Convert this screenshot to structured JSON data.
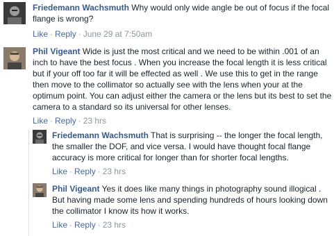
{
  "comments": [
    {
      "author": "Friedemann Wachsmuth",
      "text": "Why would only wide angle be out of focus if the focal flange is wrong?",
      "like": "Like",
      "reply": "Reply",
      "time": "June 29 at 7:50am",
      "avatar_icon": "person-photo-icon"
    },
    {
      "author": "Phil Vigeant",
      "text": "Wide is just the most critical and we need to be within .001 of an inch to have the best focus . When you increase the focal length it is less critical but if your off too far it will be effected as well . We use this to get in the range then move to the collimator so actually see with the lens when your at the optimum point. You can adjust either the camera or the lens but its best to set the camera to a standard so its universal for other lenses.",
      "like": "Like",
      "reply": "Reply",
      "time": "23 hrs",
      "avatar_icon": "person-photo-icon"
    },
    {
      "author": "Friedemann Wachsmuth",
      "text": "That is surprising -- the longer the focal length, the smaller the DOF, and vice versa. I would have thought focal flange accuracy is more critical for longer than for shorter focal lengths.",
      "like": "Like",
      "reply": "Reply",
      "time": "23 hrs",
      "avatar_icon": "person-photo-icon"
    },
    {
      "author": "Phil Vigeant",
      "text": "Yes it does like many things in photography sound illogical . But having made some lens and spending hundreds of hours looking down the collimator I know its how it works.",
      "like": "Like",
      "reply": "Reply",
      "time": "23 hrs",
      "avatar_icon": "person-photo-icon"
    }
  ],
  "colors": {
    "link": "#365899",
    "action": "#4267b2",
    "meta": "#90949c",
    "text": "#1d2129"
  }
}
